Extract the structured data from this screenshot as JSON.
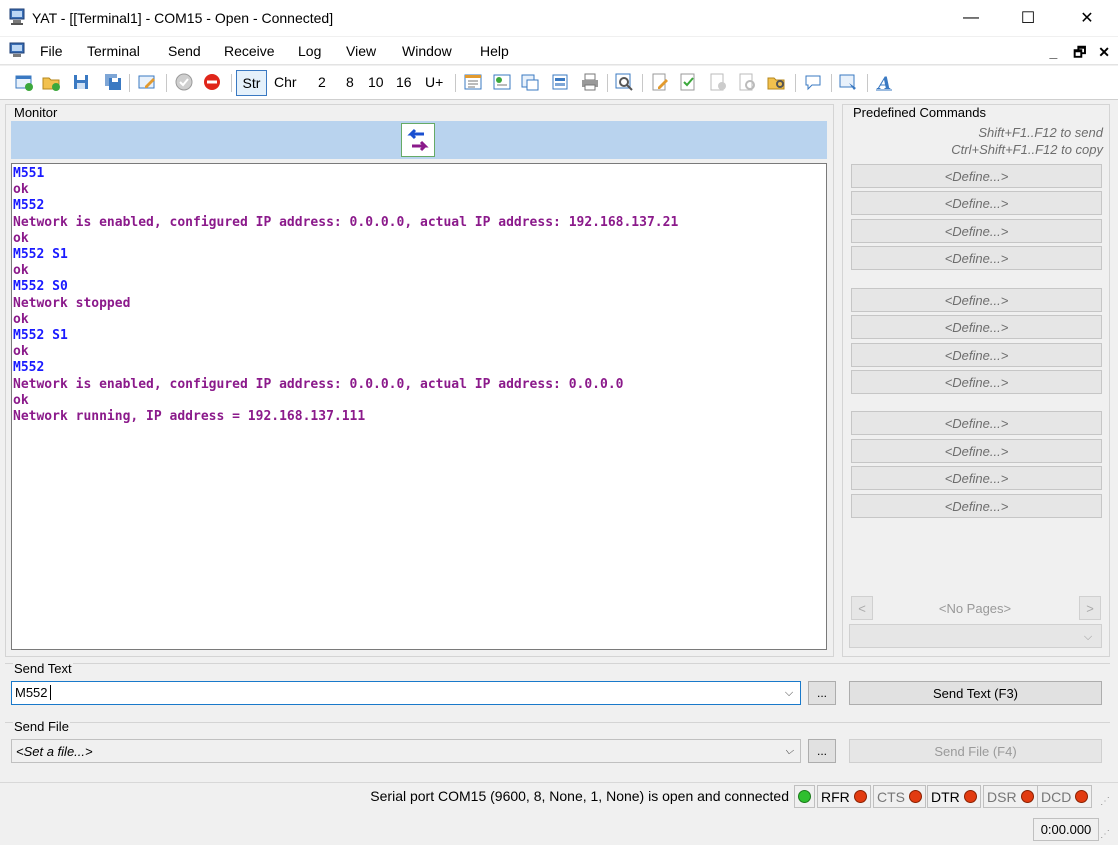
{
  "window": {
    "title": "YAT - [[Terminal1] - COM15 - Open - Connected]"
  },
  "menu": [
    "File",
    "Terminal",
    "Send",
    "Receive",
    "Log",
    "View",
    "Window",
    "Help"
  ],
  "toolbar": {
    "radix": [
      "Str",
      "Chr",
      "2",
      "8",
      "10",
      "16",
      "U+"
    ]
  },
  "monitor": {
    "label": "Monitor",
    "lines": [
      {
        "dir": "tx",
        "text": "M551"
      },
      {
        "dir": "rx",
        "text": "ok"
      },
      {
        "dir": "tx",
        "text": "M552"
      },
      {
        "dir": "rx",
        "text": "Network is enabled, configured IP address: 0.0.0.0, actual IP address: 192.168.137.21"
      },
      {
        "dir": "rx",
        "text": "ok"
      },
      {
        "dir": "tx",
        "text": "M552 S1"
      },
      {
        "dir": "rx",
        "text": "ok"
      },
      {
        "dir": "tx",
        "text": "M552 S0"
      },
      {
        "dir": "rx",
        "text": "Network stopped"
      },
      {
        "dir": "rx",
        "text": "ok"
      },
      {
        "dir": "tx",
        "text": "M552 S1"
      },
      {
        "dir": "rx",
        "text": "ok"
      },
      {
        "dir": "tx",
        "text": "M552"
      },
      {
        "dir": "rx",
        "text": "Network is enabled, configured IP address: 0.0.0.0, actual IP address: 0.0.0.0"
      },
      {
        "dir": "rx",
        "text": "ok"
      },
      {
        "dir": "rx",
        "text": "Network running, IP address = 192.168.137.111"
      }
    ]
  },
  "predefined": {
    "label": "Predefined Commands",
    "hint_send": "Shift+F1..F12 to send",
    "hint_copy": "Ctrl+Shift+F1..F12 to copy",
    "define_label": "<Define...>",
    "no_pages": "<No Pages>"
  },
  "send_text": {
    "label": "Send Text",
    "value": "M552",
    "browse": "...",
    "button": "Send Text (F3)"
  },
  "send_file": {
    "label": "Send File",
    "value": "<Set a file...>",
    "browse": "...",
    "button": "Send File (F4)"
  },
  "status": {
    "text": "Serial port COM15 (9600, 8, None, 1, None) is open and connected",
    "signals": [
      {
        "name": "RFR",
        "active": true
      },
      {
        "name": "CTS",
        "active": false
      },
      {
        "name": "DTR",
        "active": true
      },
      {
        "name": "DSR",
        "active": false
      },
      {
        "name": "DCD",
        "active": false
      }
    ],
    "timer": "0:00.000"
  },
  "colors": {
    "tx": "#1a1aff",
    "rx": "#8b1a8b",
    "led_green": "#2fbf2f",
    "led_red": "#e23b10"
  }
}
